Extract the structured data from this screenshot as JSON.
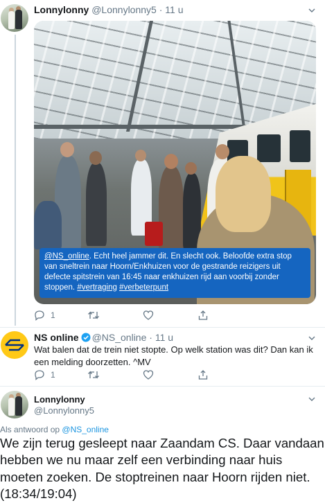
{
  "tweet1": {
    "display_name": "Lonnylonny",
    "handle": "@Lonnylonny5",
    "separator": " · ",
    "time": "11 u",
    "overlay": {
      "mention": "@NS_online",
      "text": ". Echt heel jammer dit. En slecht ook. Beloofde extra stop van sneltrein naar Hoorn/Enkhuizen voor de gestrande reizigers uit defecte spitstrein van 16:45 naar enkhuizen rijd aan voorbij zonder stoppen. ",
      "hashtag1": "#vertraging",
      "hashtag2": "#verbeterpunt"
    },
    "actions": {
      "reply_count": "1",
      "retweet_count": "",
      "like_count": ""
    }
  },
  "tweet2": {
    "display_name": "NS online",
    "handle": "@NS_online",
    "separator": " · ",
    "time": "11 u",
    "text": "Wat balen dat de trein niet stopte. Op welk station was dit? Dan kan ik een melding doorzetten. ^MV",
    "actions": {
      "reply_count": "1",
      "retweet_count": "",
      "like_count": ""
    }
  },
  "tweet3": {
    "display_name": "Lonnylonny",
    "handle": "@Lonnylonny5",
    "reply_prefix": "Als antwoord op ",
    "reply_mention": "@NS_online",
    "text": "We zijn terug gesleept naar Zaandam CS. Daar vandaan hebben we nu maar zelf een verbinding naar huis moeten zoeken. De stoptreinen naar Hoorn rijden niet. (18:34/19:04)"
  },
  "icons": [
    "caret-down-icon",
    "reply-icon",
    "retweet-icon",
    "like-icon",
    "share-icon",
    "verified-icon",
    "ns-logo-icon"
  ],
  "colors": {
    "link": "#1b95e0",
    "secondary": "#657786",
    "ns_yellow": "#ffc917",
    "ns_blue": "#003082",
    "overlay_blue": "#1565c0"
  }
}
